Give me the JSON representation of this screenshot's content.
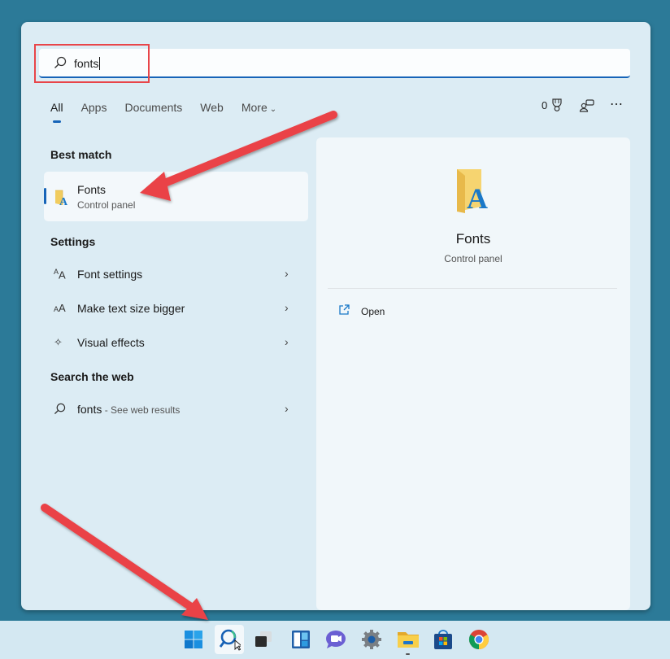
{
  "search": {
    "query": "fonts"
  },
  "tabs": [
    {
      "label": "All",
      "active": true
    },
    {
      "label": "Apps"
    },
    {
      "label": "Documents"
    },
    {
      "label": "Web"
    },
    {
      "label": "More",
      "icon": "chevron-down-icon"
    }
  ],
  "header_right": {
    "rewards_count": "0",
    "rewards_icon": "trophy-icon",
    "account_icon": "account-switch-icon",
    "more_icon": "more-dots-icon"
  },
  "best_match": {
    "section_label": "Best match",
    "title": "Fonts",
    "subtitle": "Control panel",
    "icon": "fonts-folder-icon"
  },
  "settings": {
    "section_label": "Settings",
    "items": [
      {
        "label": "Font settings",
        "icon": "font-settings-icon"
      },
      {
        "label": "Make text size bigger",
        "icon": "text-size-icon"
      },
      {
        "label": "Visual effects",
        "icon": "sparkle-icon"
      }
    ]
  },
  "web": {
    "section_label": "Search the web",
    "query": "fonts",
    "hint": " - See web results",
    "icon": "search-icon"
  },
  "detail": {
    "title": "Fonts",
    "subtitle": "Control panel",
    "actions": [
      {
        "label": "Open",
        "icon": "open-external-icon"
      }
    ]
  },
  "taskbar": {
    "items": [
      "start",
      "search",
      "task-view",
      "widgets",
      "chat",
      "settings",
      "file-explorer",
      "store",
      "chrome"
    ],
    "active": "search"
  },
  "colors": {
    "accent": "#1664b8",
    "annotation": "#e84549",
    "desktop": "#2c7a98"
  }
}
